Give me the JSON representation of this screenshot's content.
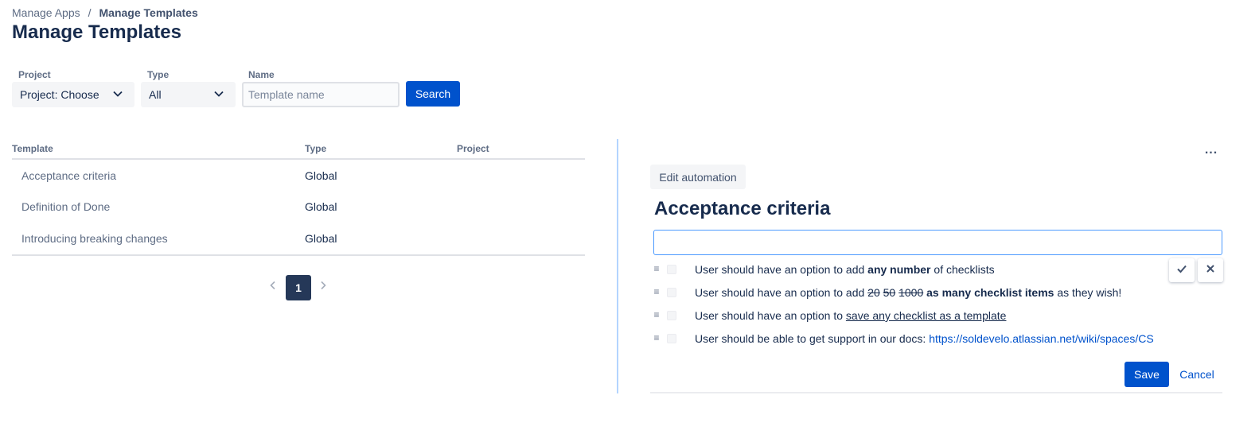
{
  "breadcrumb": {
    "parent": "Manage Apps",
    "separator": "/",
    "current": "Manage Templates"
  },
  "page": {
    "title": "Manage Templates"
  },
  "filters": {
    "project": {
      "label": "Project",
      "value": "Project: Choose"
    },
    "type": {
      "label": "Type",
      "value": "All"
    },
    "name": {
      "label": "Name",
      "placeholder": "Template name",
      "value": ""
    },
    "search_label": "Search"
  },
  "table": {
    "headers": {
      "template": "Template",
      "type": "Type",
      "project": "Project"
    },
    "rows": [
      {
        "name": "Acceptance criteria",
        "type": "Global",
        "project": ""
      },
      {
        "name": "Definition of Done",
        "type": "Global",
        "project": ""
      },
      {
        "name": "Introducing breaking changes",
        "type": "Global",
        "project": ""
      }
    ]
  },
  "pagination": {
    "current_page": "1"
  },
  "detail": {
    "more_label": "...",
    "edit_automation_label": "Edit automation",
    "title": "Acceptance criteria",
    "title_input_value": "",
    "items": [
      {
        "prefix": "User should have an option to add ",
        "bold": "any number",
        "suffix": " of checklists"
      },
      {
        "prefix": "User should have an option to add ",
        "strike1": "20",
        "strike2": "50",
        "strike3": "1000",
        "bold": "as many checklist items",
        "suffix": " as they wish!"
      },
      {
        "prefix": "User should have an option to ",
        "underline": "save any checklist as a template"
      },
      {
        "prefix": "User should be able to get support in our docs: ",
        "link": "https://soldevelo.atlassian.net/wiki/spaces/CS"
      }
    ],
    "save_label": "Save",
    "cancel_label": "Cancel"
  },
  "colors": {
    "primary": "#0052cc",
    "text": "#172b4d",
    "subtle": "#5e6c84",
    "page_current": "#253858",
    "focus": "#4c9aff"
  },
  "icons": {
    "select_chevron": "chevron-down-icon",
    "pagination_prev": "chevron-left-icon",
    "pagination_next": "chevron-right-icon",
    "confirm": "check-icon",
    "cancel": "close-icon",
    "item_handle": "drag-handle-icon"
  }
}
